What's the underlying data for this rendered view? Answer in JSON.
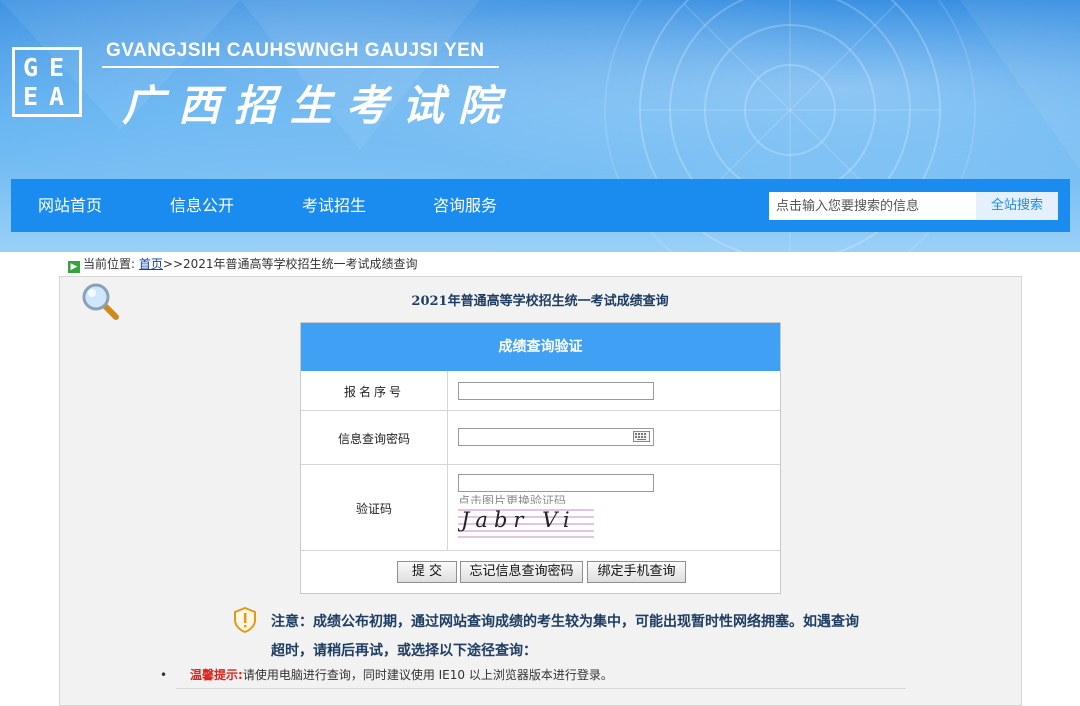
{
  "header": {
    "logo_letters": [
      "G",
      "E",
      "E",
      "A"
    ],
    "title_en": "GVANGJSIH CAUHSWNGH GAUJSI YEN",
    "title_cn": "广西招生考试院"
  },
  "nav": {
    "items": [
      "网站首页",
      "信息公开",
      "考试招生",
      "咨询服务"
    ],
    "search_placeholder": "点击输入您要搜索的信息",
    "search_button": "全站搜索"
  },
  "breadcrumb": {
    "prefix": "当前位置:",
    "home": "首页",
    "current": ">>2021年普通高等学校招生统一考试成绩查询"
  },
  "page": {
    "title": "2021年普通高等学校招生统一考试成绩查询"
  },
  "form": {
    "header": "成绩查询验证",
    "fields": [
      {
        "label": "报名序号",
        "value": ""
      },
      {
        "label": "信息查询密码",
        "value": ""
      },
      {
        "label": "验证码",
        "value": ""
      }
    ],
    "captcha_hint": "点击图片更换验证码",
    "captcha_text": "Jabr Vi",
    "buttons": {
      "submit": "提 交",
      "forgot": "忘记信息查询密码",
      "bind_phone": "绑定手机查询"
    }
  },
  "notice": {
    "text": "注意：成绩公布初期，通过网站查询成绩的考生较为集中，可能出现暂时性网络拥塞。如遇查询超时，请稍后再试，或选择以下途径查询："
  },
  "tip": {
    "bullet": "•",
    "label": "温馨提示:",
    "text": "请使用电脑进行查询，同时建议使用 IE10 以上浏览器版本进行登录。"
  },
  "colors": {
    "nav_blue": "#1a8cf0",
    "form_header_blue": "#3fa0f4",
    "notice_text": "#1d3d63",
    "tip_red": "#d9261c"
  }
}
